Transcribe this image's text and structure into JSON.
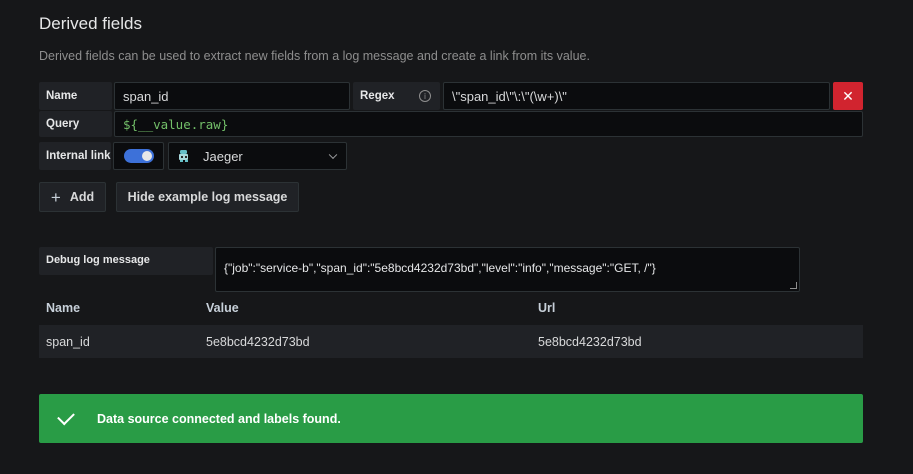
{
  "section": {
    "title": "Derived fields",
    "description": "Derived fields can be used to extract new fields from a log message and create a link from its value."
  },
  "field": {
    "name_label": "Name",
    "name_value": "span_id",
    "regex_label": "Regex",
    "regex_info_icon": "info-icon",
    "regex_value": "\\\"span_id\\\"\\:\\\"(\\w+)\\\"",
    "delete_icon": "close-icon",
    "delete_symbol": "✕",
    "query_label": "Query",
    "query_value": "${__value.raw}",
    "internal_link_label": "Internal link",
    "internal_link_enabled": true,
    "datasource_icon": "jaeger-icon",
    "datasource_value": "Jaeger"
  },
  "actions": {
    "add_symbol": "+",
    "add_label": "Add",
    "hide_example_label": "Hide example log message"
  },
  "debug": {
    "label": "Debug log message",
    "message": "{\"job\":\"service-b\",\"span_id\":\"5e8bcd4232d73bd\",\"level\":\"info\",\"message\":\"GET, /\"}"
  },
  "results": {
    "headers": [
      "Name",
      "Value",
      "Url"
    ],
    "rows": [
      [
        "span_id",
        "5e8bcd4232d73bd",
        "5e8bcd4232d73bd"
      ]
    ]
  },
  "alert": {
    "icon": "check-icon",
    "text": "Data source connected and labels found.",
    "color": "#299c46"
  }
}
